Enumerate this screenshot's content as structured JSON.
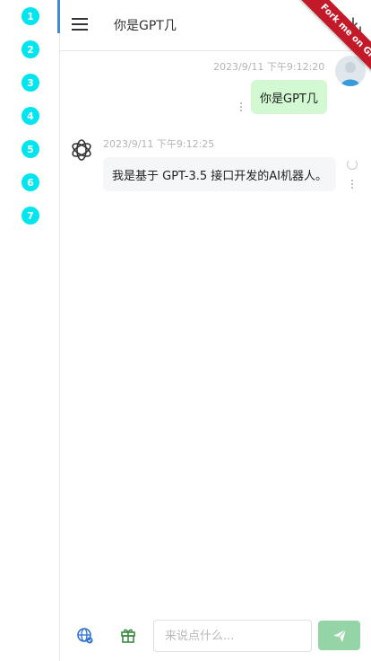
{
  "rail": {
    "items": [
      "1",
      "2",
      "3",
      "4",
      "5",
      "6",
      "7"
    ],
    "color": "#00e5ee"
  },
  "header": {
    "title": "你是GPT几",
    "menu_icon": "hamburger-icon",
    "download_icon": "download-icon"
  },
  "ribbon": {
    "text": "Fork me on Gitee",
    "color": "#c31a2a"
  },
  "messages": [
    {
      "role": "user",
      "time": "2023/9/11 下午9:12:20",
      "text": "你是GPT几"
    },
    {
      "role": "bot",
      "time": "2023/9/11 下午9:12:25",
      "text": "我是基于 GPT-3.5 接口开发的AI机器人。"
    }
  ],
  "composer": {
    "placeholder": "来说点什么...",
    "value": "",
    "send_color": "#95d4a6"
  }
}
